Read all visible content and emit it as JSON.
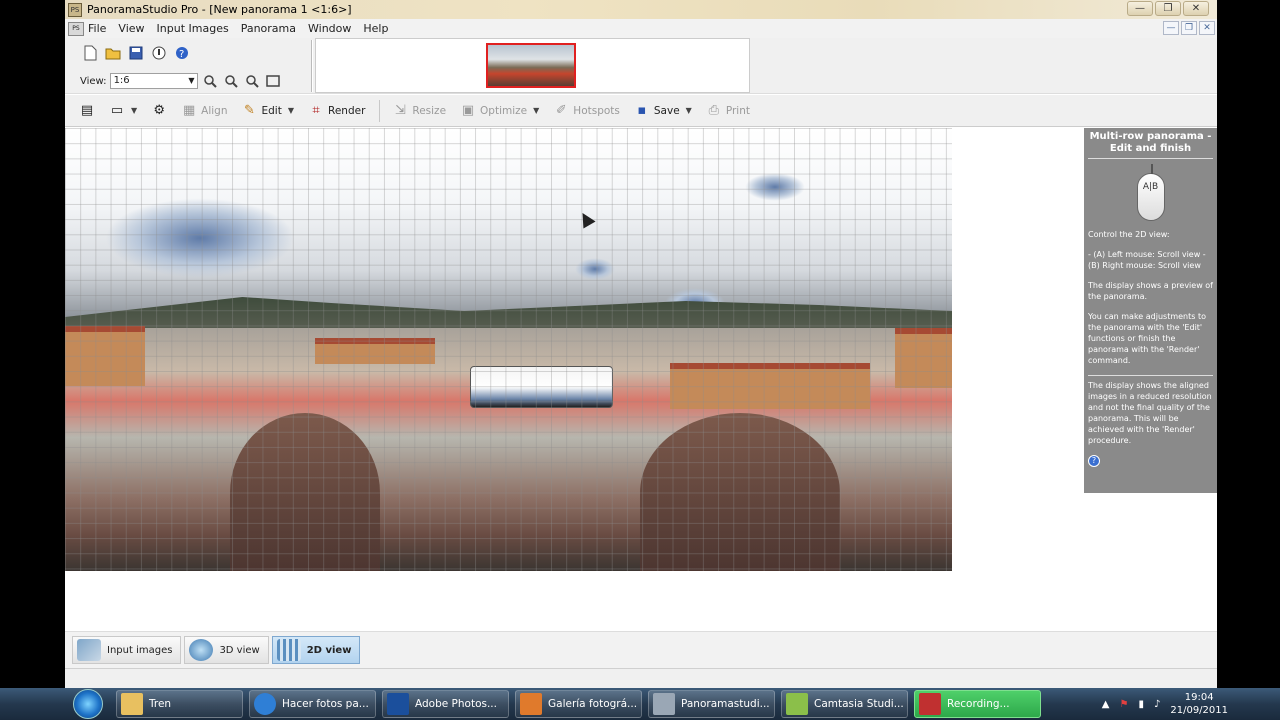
{
  "window": {
    "title": "PanoramaStudio Pro - [New panorama 1 <1:6>]",
    "controls": [
      "—",
      "❐",
      "✕"
    ],
    "mdi_controls": [
      "—",
      "❐",
      "✕"
    ]
  },
  "menu": [
    "File",
    "View",
    "Input Images",
    "Panorama",
    "Window",
    "Help"
  ],
  "topbar": {
    "view_label": "View:",
    "view_value": "1:6"
  },
  "toolbar": {
    "align": "Align",
    "edit": "Edit",
    "render": "Render",
    "resize": "Resize",
    "optimize": "Optimize",
    "hotspots": "Hotspots",
    "save": "Save",
    "print": "Print"
  },
  "help": {
    "title": "Multi-row panorama - Edit and finish",
    "mouse_label": "A|B",
    "p1": "Control the 2D view:",
    "p2": "- (A) Left mouse: Scroll view - (B) Right mouse: Scroll view",
    "p3": "The display shows a preview of the panorama.",
    "p4": "You can make adjustments to the panorama with the 'Edit' functions or finish the panorama with the 'Render' command.",
    "note": "The display shows the aligned images in a reduced resolution and not the final quality of the panorama. This will be achieved with the 'Render' procedure.",
    "icon": "?"
  },
  "tabs": {
    "input_images": "Input images",
    "view3d": "3D view",
    "view2d": "2D view"
  },
  "taskbar": {
    "items": [
      {
        "label": "Tren",
        "color": "#e8c060"
      },
      {
        "label": "Hacer fotos pa...",
        "color": "#2f7fd6"
      },
      {
        "label": "Adobe Photos...",
        "color": "#1b4f9c"
      },
      {
        "label": "Galería fotográ...",
        "color": "#e07a2c"
      },
      {
        "label": "Panoramastudi...",
        "color": "#9aa7b5"
      },
      {
        "label": "Camtasia Studi...",
        "color": "#8bbf4a"
      },
      {
        "label": "Recording...",
        "color": "#c03030"
      }
    ],
    "time": "19:04",
    "date": "21/09/2011"
  }
}
